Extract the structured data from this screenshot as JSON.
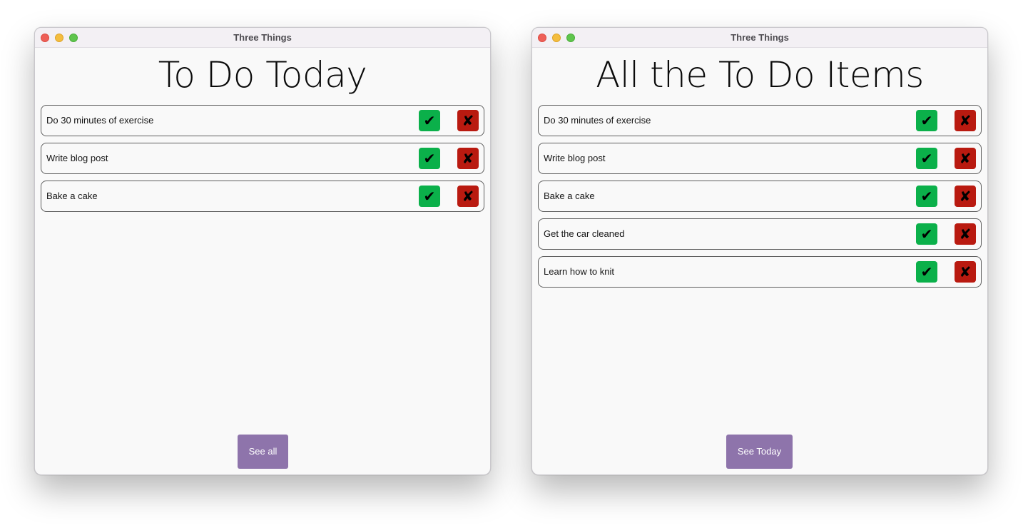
{
  "left_window": {
    "title": "Three Things",
    "heading": "To Do Today",
    "items": [
      {
        "text": "Do 30 minutes of exercise"
      },
      {
        "text": "Write blog post"
      },
      {
        "text": "Bake a cake"
      }
    ],
    "footer_button": "See all"
  },
  "right_window": {
    "title": "Three Things",
    "heading": "All the To Do Items",
    "items": [
      {
        "text": "Do 30 minutes of exercise"
      },
      {
        "text": "Write blog post"
      },
      {
        "text": "Bake a cake"
      },
      {
        "text": "Get the car cleaned"
      },
      {
        "text": "Learn how to knit"
      }
    ],
    "footer_button": "See Today"
  },
  "icons": {
    "done": "✔",
    "remove": "✘"
  },
  "colors": {
    "done_button": "#0bb04a",
    "remove_button": "#b91a10",
    "footer_button": "#8e74ab"
  }
}
